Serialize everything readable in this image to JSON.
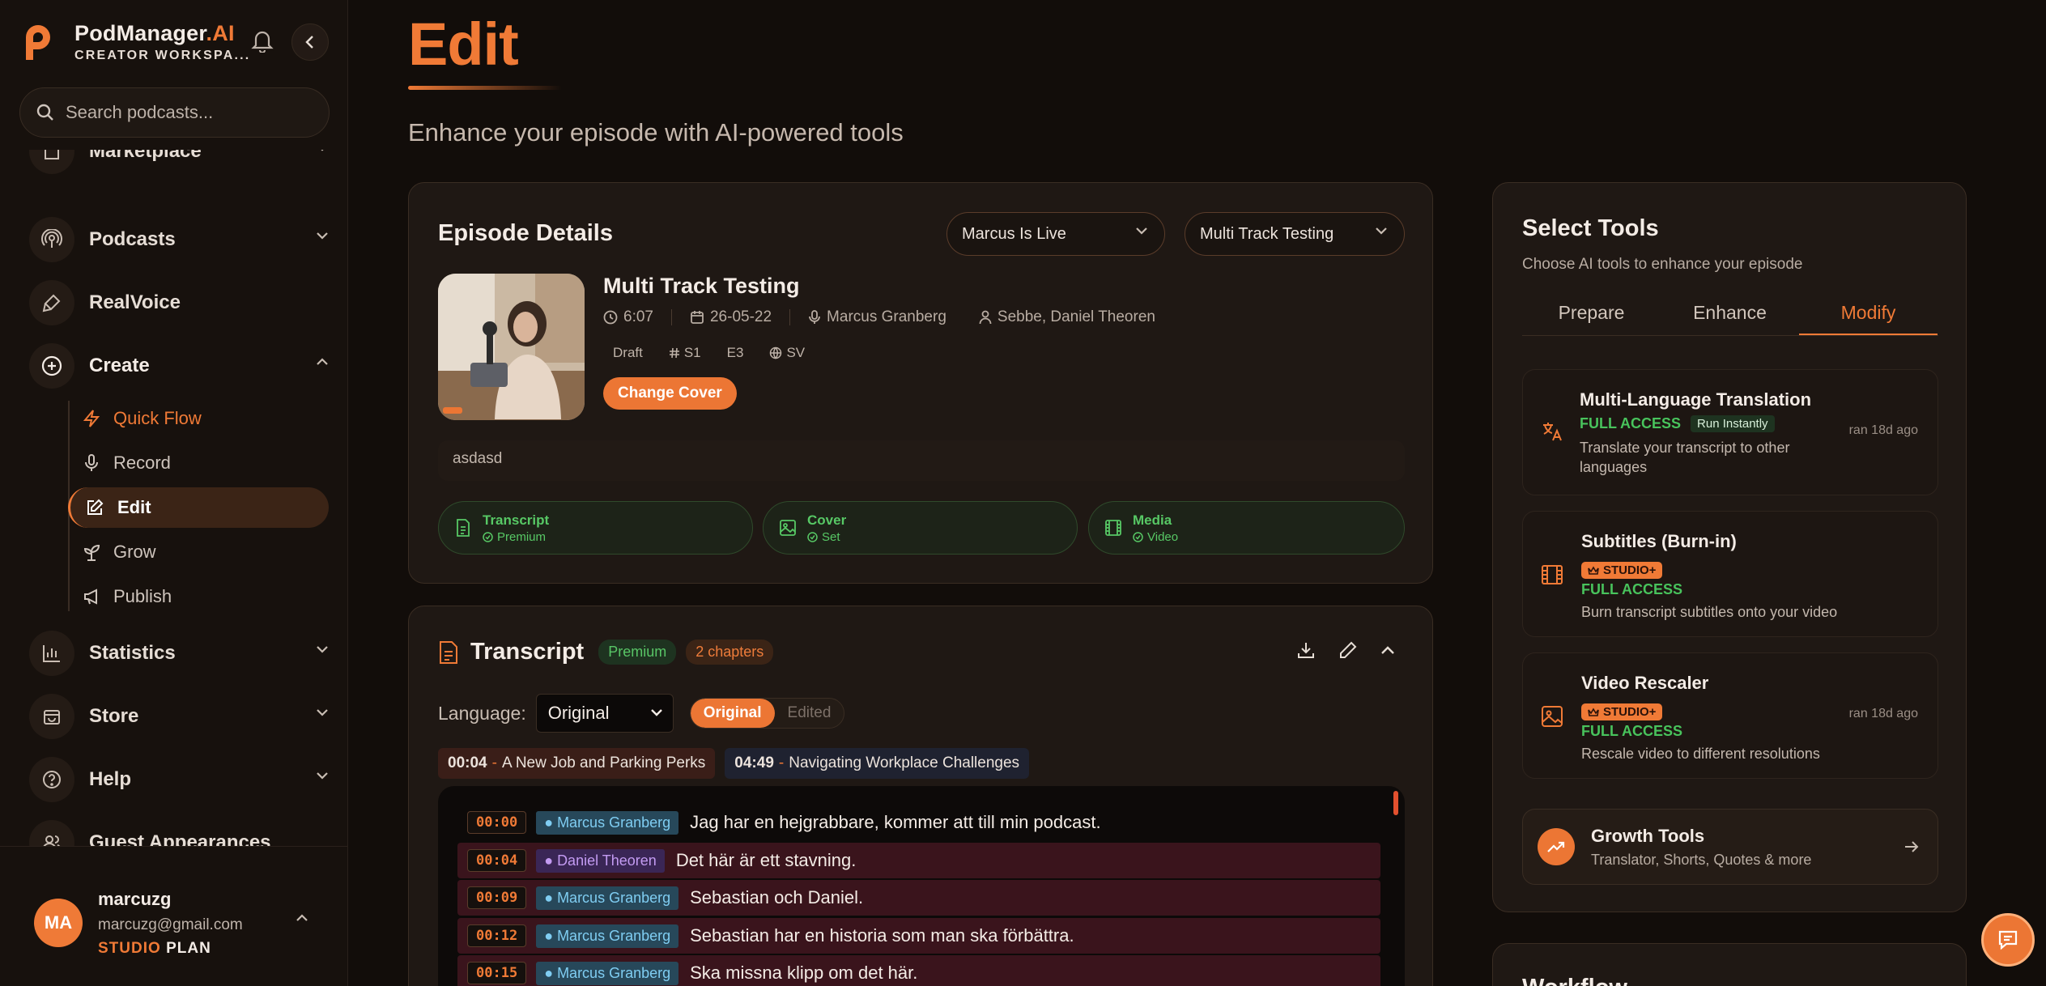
{
  "brand": {
    "name": "PodManager",
    "name_ai": ".AI",
    "subtitle": "CREATOR WORKSPA..."
  },
  "search": {
    "placeholder": "Search podcasts..."
  },
  "nav": {
    "marketplace": "Marketplace",
    "podcasts": "Podcasts",
    "realvoice": "RealVoice",
    "create": "Create",
    "create_items": {
      "quick_flow": "Quick Flow",
      "record": "Record",
      "edit": "Edit",
      "grow": "Grow",
      "publish": "Publish"
    },
    "statistics": "Statistics",
    "store": "Store",
    "help": "Help",
    "guest_appearances": "Guest Appearances"
  },
  "user": {
    "initials": "MA",
    "name": "marcuzg",
    "email": "marcuzg@gmail.com",
    "plan_tier": "STUDIO",
    "plan_word": "PLAN"
  },
  "page": {
    "title": "Edit",
    "subtitle": "Enhance your episode with AI-powered tools"
  },
  "episode": {
    "card_title": "Episode Details",
    "podcast_select": "Marcus Is Live",
    "episode_select": "Multi Track Testing",
    "title": "Multi Track Testing",
    "duration": "6:07",
    "date": "26-05-22",
    "host": "Marcus Granberg",
    "guests": "Sebbe, Daniel Theoren",
    "status": "Draft",
    "season": "S1",
    "episode_no": "E3",
    "language": "SV",
    "change_cover": "Change Cover",
    "description": "asdasd",
    "statuses": [
      {
        "title": "Transcript",
        "value": "Premium"
      },
      {
        "title": "Cover",
        "value": "Set"
      },
      {
        "title": "Media",
        "value": "Video"
      }
    ]
  },
  "transcript": {
    "title": "Transcript",
    "badge": "Premium",
    "chapters_badge": "2 chapters",
    "language_label": "Language:",
    "language_value": "Original",
    "toggle_original": "Original",
    "toggle_edited": "Edited",
    "chapters": [
      {
        "time": "00:04",
        "title": "A New Job and Parking Perks"
      },
      {
        "time": "04:49",
        "title": "Navigating Workplace Challenges"
      }
    ],
    "lines": [
      {
        "time": "00:00",
        "speaker": "Marcus Granberg",
        "text": "Jag har en hejgrabbare, kommer att till min podcast."
      },
      {
        "time": "00:04",
        "speaker": "Daniel Theoren",
        "text": "Det här är ett stavning."
      },
      {
        "time": "00:09",
        "speaker": "Marcus Granberg",
        "text": "Sebastian och Daniel."
      },
      {
        "time": "00:12",
        "speaker": "Marcus Granberg",
        "text": "Sebastian har en historia som man ska förbättra."
      },
      {
        "time": "00:15",
        "speaker": "Marcus Granberg",
        "text": "Ska missna klipp om det här."
      }
    ]
  },
  "tools": {
    "title": "Select Tools",
    "subtitle": "Choose AI tools to enhance your episode",
    "tabs": [
      "Prepare",
      "Enhance",
      "Modify"
    ],
    "active_tab": "Modify",
    "items": [
      {
        "name": "Multi-Language Translation",
        "access": "FULL ACCESS",
        "extra": "Run Instantly",
        "desc": "Translate your transcript to other languages",
        "ran": "ran 18d ago"
      },
      {
        "name": "Subtitles (Burn-in)",
        "tier": "STUDIO+",
        "access": "FULL ACCESS",
        "desc": "Burn transcript subtitles onto your video"
      },
      {
        "name": "Video Rescaler",
        "tier": "STUDIO+",
        "access": "FULL ACCESS",
        "desc": "Rescale video to different resolutions",
        "ran": "ran 18d ago"
      }
    ],
    "growth": {
      "title": "Growth Tools",
      "subtitle": "Translator, Shorts, Quotes & more"
    }
  },
  "workflow": {
    "title": "Workflow"
  },
  "colors": {
    "accent": "#f07a36",
    "success": "#48c35c",
    "background": "#120d0a"
  }
}
